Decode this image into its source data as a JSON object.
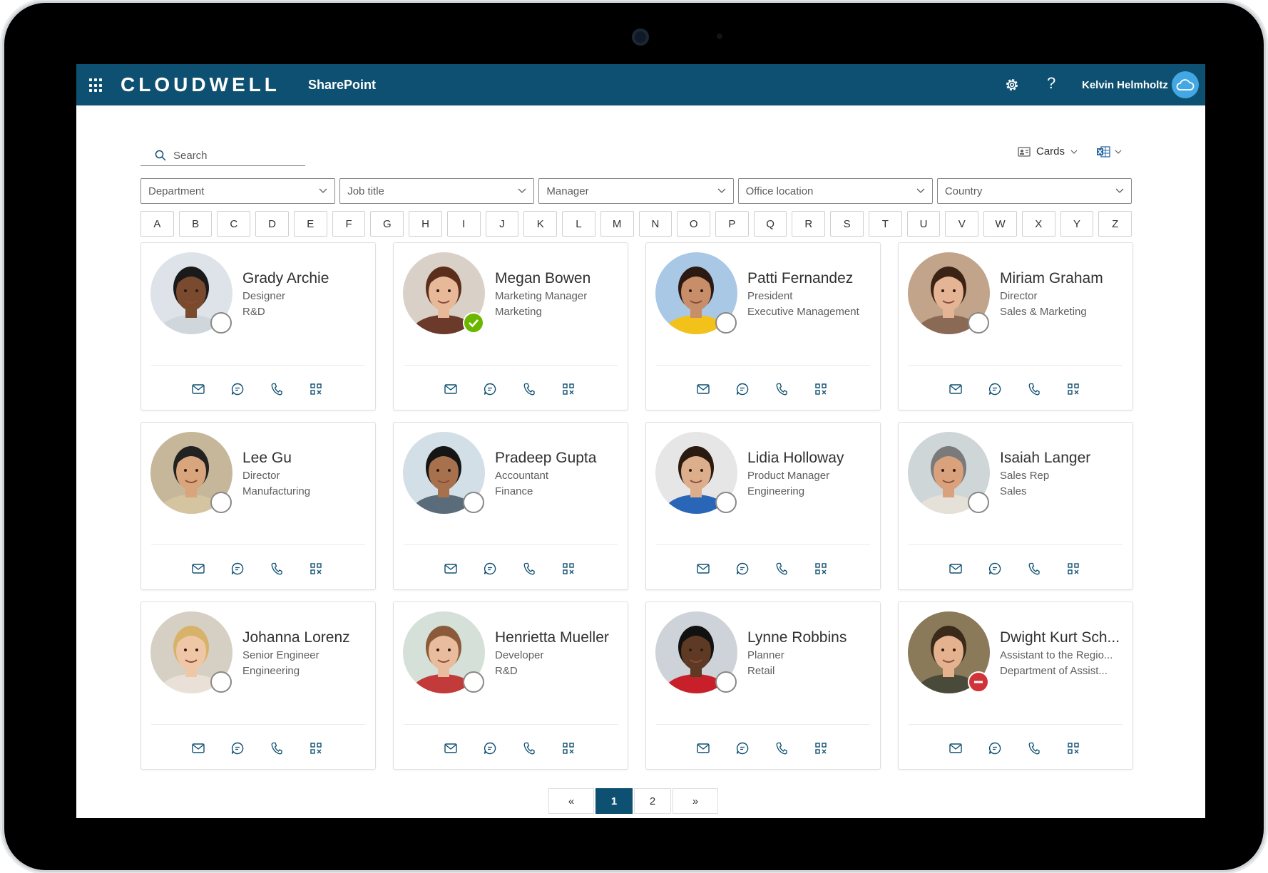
{
  "header": {
    "brand": "CLOUDWELL",
    "site": "SharePoint",
    "user_name": "Kelvin Helmholtz",
    "help_label": "?"
  },
  "search": {
    "placeholder": "Search"
  },
  "view": {
    "mode_label": "Cards"
  },
  "filters": [
    "Department",
    "Job title",
    "Manager",
    "Office location",
    "Country"
  ],
  "alphabet": [
    "A",
    "B",
    "C",
    "D",
    "E",
    "F",
    "G",
    "H",
    "I",
    "J",
    "K",
    "L",
    "M",
    "N",
    "O",
    "P",
    "Q",
    "R",
    "S",
    "T",
    "U",
    "V",
    "W",
    "X",
    "Y",
    "Z"
  ],
  "people": [
    {
      "name": "Grady Archie",
      "title": "Designer",
      "department": "R&D",
      "presence": "offline",
      "skin": "#7a4a2e",
      "hair": "#1a1a1a",
      "bg": "#dde3e8",
      "shirt": "#cfd6dc"
    },
    {
      "name": "Megan Bowen",
      "title": "Marketing Manager",
      "department": "Marketing",
      "presence": "available",
      "skin": "#e7b999",
      "hair": "#5a2e1a",
      "bg": "#d9d0c8",
      "shirt": "#6b3a2a"
    },
    {
      "name": "Patti Fernandez",
      "title": "President",
      "department": "Executive Management",
      "presence": "offline",
      "skin": "#c78e69",
      "hair": "#2b1a12",
      "bg": "#a9c8e6",
      "shirt": "#f3c21a"
    },
    {
      "name": "Miriam Graham",
      "title": "Director",
      "department": "Sales & Marketing",
      "presence": "offline",
      "skin": "#e4b494",
      "hair": "#3a2214",
      "bg": "#c2a48a",
      "shirt": "#8a6a55"
    },
    {
      "name": "Lee Gu",
      "title": "Director",
      "department": "Manufacturing",
      "presence": "offline",
      "skin": "#d8a57c",
      "hair": "#222222",
      "bg": "#c7b79a",
      "shirt": "#d4c4a0"
    },
    {
      "name": "Pradeep Gupta",
      "title": "Accountant",
      "department": "Finance",
      "presence": "offline",
      "skin": "#a8714d",
      "hair": "#151515",
      "bg": "#d2dfe6",
      "shirt": "#5a6b7a"
    },
    {
      "name": "Lidia Holloway",
      "title": "Product Manager",
      "department": "Engineering",
      "presence": "offline",
      "skin": "#dcae8c",
      "hair": "#2a1a10",
      "bg": "#e6e6e6",
      "shirt": "#2a66b8"
    },
    {
      "name": "Isaiah Langer",
      "title": "Sales Rep",
      "department": "Sales",
      "presence": "offline",
      "skin": "#d9a27c",
      "hair": "#7a7a7a",
      "bg": "#cfd6d8",
      "shirt": "#e5e0d8"
    },
    {
      "name": "Johanna Lorenz",
      "title": "Senior Engineer",
      "department": "Engineering",
      "presence": "offline",
      "skin": "#efc7a6",
      "hair": "#d7b36a",
      "bg": "#d6d0c4",
      "shirt": "#e9e1d7"
    },
    {
      "name": "Henrietta Mueller",
      "title": "Developer",
      "department": "R&D",
      "presence": "offline",
      "skin": "#e8bc9c",
      "hair": "#8a5a3a",
      "bg": "#d4e0d8",
      "shirt": "#c33a3a"
    },
    {
      "name": "Lynne Robbins",
      "title": "Planner",
      "department": "Retail",
      "presence": "offline",
      "skin": "#5e3a24",
      "hair": "#111111",
      "bg": "#cdd3d8",
      "shirt": "#c8202a"
    },
    {
      "name": "Dwight Kurt Sch...",
      "title": "Assistant to the Regio...",
      "department": "Department of Assist...",
      "presence": "dnd",
      "skin": "#e4b28f",
      "hair": "#3a2a1a",
      "bg": "#8a7a5a",
      "shirt": "#4a4a3a"
    }
  ],
  "pagination": {
    "prev": "«",
    "pages": [
      "1",
      "2"
    ],
    "current": "1",
    "next": "»"
  },
  "colors": {
    "header_bg": "#0e5071",
    "available": "#6bb700",
    "dnd": "#d13438",
    "action_icon": "#0e5071"
  }
}
